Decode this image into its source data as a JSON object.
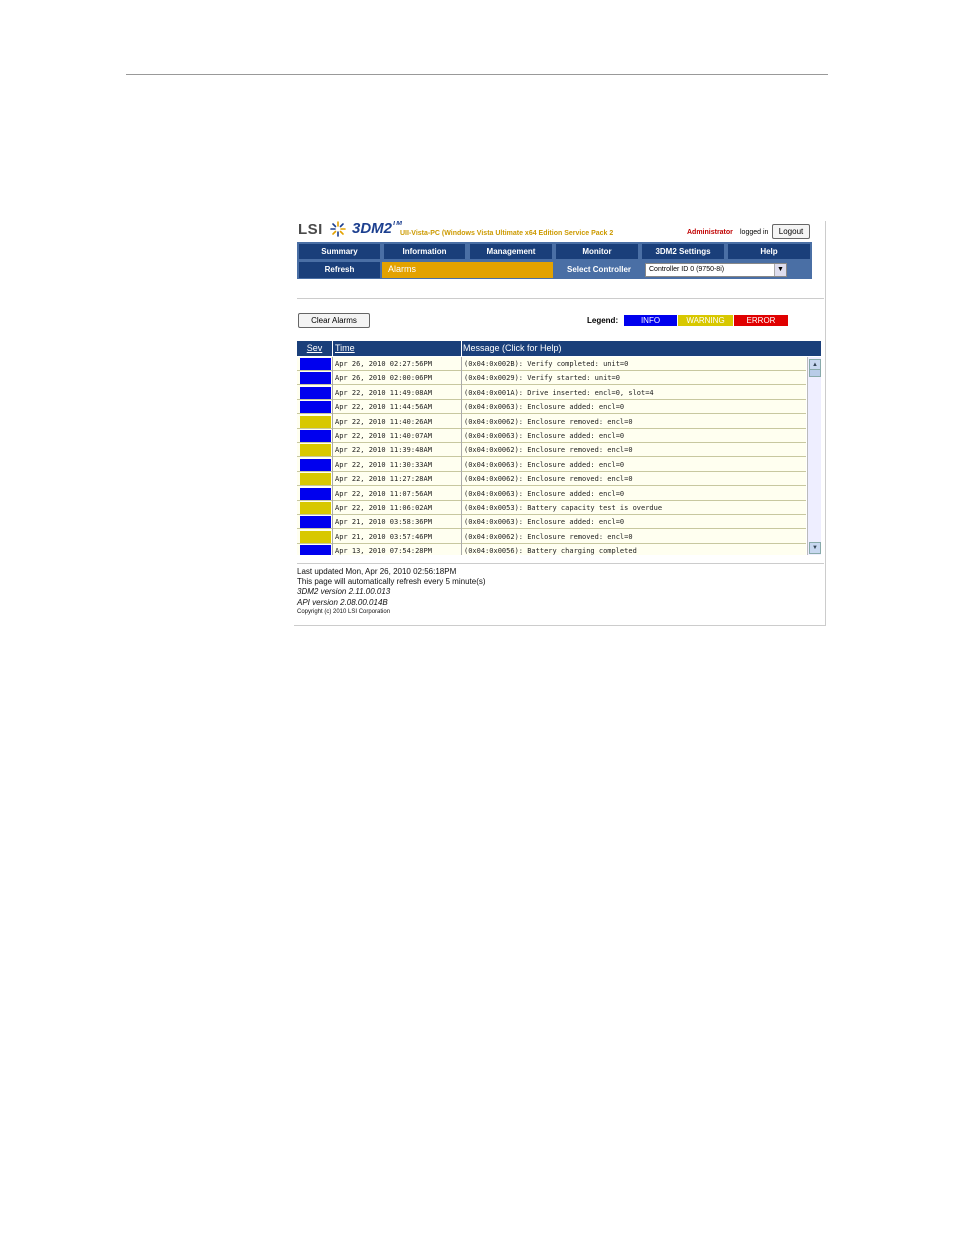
{
  "header": {
    "brand": "LSI",
    "product": "3DM2",
    "tm": "TM",
    "host": "UII-Vista-PC (Windows Vista Ultimate x64 Edition Service Pack 2",
    "user": "Administrator",
    "logged_in": "logged in",
    "logout": "Logout"
  },
  "nav": {
    "row1": [
      "Summary",
      "Information",
      "Management",
      "Monitor",
      "3DM2 Settings",
      "Help"
    ],
    "refresh": "Refresh",
    "current": "Alarms",
    "select_controller": "Select Controller",
    "controller_value": "Controller ID 0 (9750-8i)"
  },
  "toolbar": {
    "clear": "Clear Alarms"
  },
  "legend": {
    "label": "Legend:",
    "info": "INFO",
    "warning": "WARNING",
    "error": "ERROR"
  },
  "colors": {
    "info": "#0000ee",
    "warning": "#d8c800",
    "error": "#e00000",
    "nav": "#1a3f7a",
    "accent": "#e3a200"
  },
  "table": {
    "headers": {
      "sev": "Sev",
      "time": "Time",
      "message": "Message (Click for Help)"
    },
    "rows": [
      {
        "sev": "info",
        "time": "Apr 26, 2010 02:27:56PM",
        "message": "(0x04:0x002B): Verify completed: unit=0"
      },
      {
        "sev": "info",
        "time": "Apr 26, 2010 02:00:06PM",
        "message": "(0x04:0x0029): Verify started: unit=0"
      },
      {
        "sev": "info",
        "time": "Apr 22, 2010 11:49:08AM",
        "message": "(0x04:0x001A): Drive inserted: encl=0, slot=4"
      },
      {
        "sev": "info",
        "time": "Apr 22, 2010 11:44:56AM",
        "message": "(0x04:0x0063): Enclosure added: encl=0"
      },
      {
        "sev": "warning",
        "time": "Apr 22, 2010 11:40:26AM",
        "message": "(0x04:0x0062): Enclosure removed: encl=0"
      },
      {
        "sev": "info",
        "time": "Apr 22, 2010 11:40:07AM",
        "message": "(0x04:0x0063): Enclosure added: encl=0"
      },
      {
        "sev": "warning",
        "time": "Apr 22, 2010 11:39:48AM",
        "message": "(0x04:0x0062): Enclosure removed: encl=0"
      },
      {
        "sev": "info",
        "time": "Apr 22, 2010 11:30:33AM",
        "message": "(0x04:0x0063): Enclosure added: encl=0"
      },
      {
        "sev": "warning",
        "time": "Apr 22, 2010 11:27:28AM",
        "message": "(0x04:0x0062): Enclosure removed: encl=0"
      },
      {
        "sev": "info",
        "time": "Apr 22, 2010 11:07:56AM",
        "message": "(0x04:0x0063): Enclosure added: encl=0"
      },
      {
        "sev": "warning",
        "time": "Apr 22, 2010 11:06:02AM",
        "message": "(0x04:0x0053): Battery capacity test is overdue"
      },
      {
        "sev": "info",
        "time": "Apr 21, 2010 03:58:36PM",
        "message": "(0x04:0x0063): Enclosure added: encl=0"
      },
      {
        "sev": "warning",
        "time": "Apr 21, 2010 03:57:46PM",
        "message": "(0x04:0x0062): Enclosure removed: encl=0"
      },
      {
        "sev": "info",
        "time": "Apr 13, 2010 07:54:28PM",
        "message": "(0x04:0x0056): Battery charging completed"
      }
    ]
  },
  "footer": {
    "updated": "Last updated Mon, Apr 26, 2010 02:56:18PM",
    "refresh": "This page will automatically refresh every 5 minute(s)",
    "version": "3DM2 version 2.11.00.013",
    "api": "API version 2.08.00.014B",
    "copyright": "Copyright (c) 2010 LSI Corporation"
  }
}
